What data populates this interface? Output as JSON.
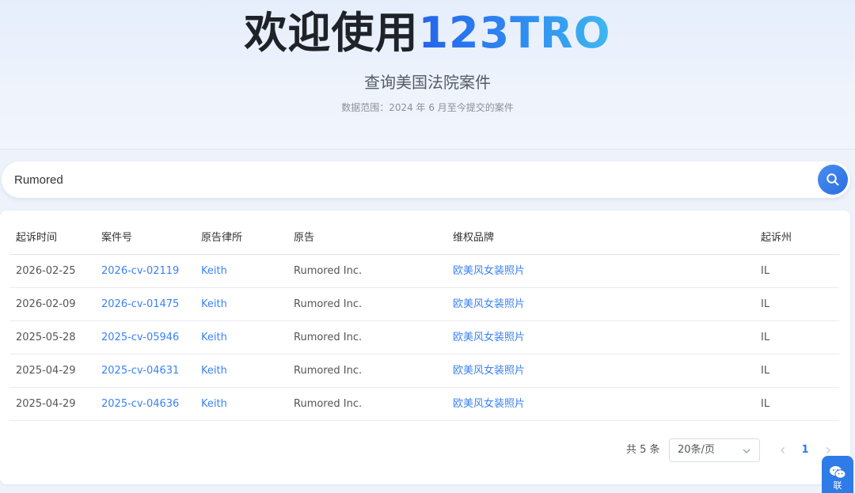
{
  "hero": {
    "title_prefix": "欢迎使用",
    "title_brand": "123TRO",
    "subtitle": "查询美国法院案件",
    "data_range": "数据范围：2024 年 6 月至今提交的案件"
  },
  "search": {
    "value": "Rumored"
  },
  "table": {
    "columns": [
      "起诉时间",
      "案件号",
      "原告律所",
      "原告",
      "维权品牌",
      "起诉州"
    ],
    "rows": [
      [
        "2026-02-25",
        "2026-cv-02119",
        "Keith",
        "Rumored Inc.",
        "欧美风女装照片",
        "IL"
      ],
      [
        "2026-02-09",
        "2026-cv-01475",
        "Keith",
        "Rumored Inc.",
        "欧美风女装照片",
        "IL"
      ],
      [
        "2025-05-28",
        "2025-cv-05946",
        "Keith",
        "Rumored Inc.",
        "欧美风女装照片",
        "IL"
      ],
      [
        "2025-04-29",
        "2025-cv-04631",
        "Keith",
        "Rumored Inc.",
        "欧美风女装照片",
        "IL"
      ],
      [
        "2025-04-29",
        "2025-cv-04636",
        "Keith",
        "Rumored Inc.",
        "欧美风女装照片",
        "IL"
      ]
    ]
  },
  "pagination": {
    "total": "共 5 条",
    "page_size": "20条/页",
    "current_page": "1"
  },
  "floating": {
    "chat_label": "联"
  },
  "colors": {
    "accent": "#2f7be8",
    "link": "#3b82f6"
  },
  "icons": {
    "search": "search-icon",
    "dropdown": "chevron-down-icon",
    "prev": "chevron-left-icon",
    "next": "chevron-right-icon",
    "chat": "wechat-icon"
  }
}
